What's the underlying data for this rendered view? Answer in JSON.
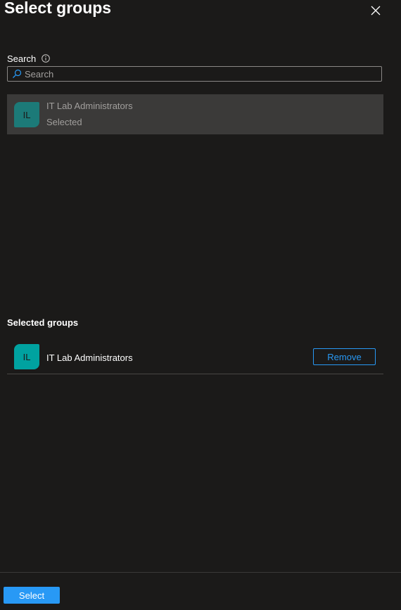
{
  "panel": {
    "title": "Select groups"
  },
  "icons": {
    "close": "close-icon",
    "info": "info-icon",
    "search": "search-icon"
  },
  "search": {
    "label": "Search",
    "placeholder": "Search",
    "value": ""
  },
  "results": [
    {
      "initials": "IL",
      "name": "IT Lab Administrators",
      "status": "Selected",
      "avatar_color": "#1c7a78"
    }
  ],
  "selected_section": {
    "title": "Selected groups",
    "items": [
      {
        "initials": "IL",
        "name": "IT Lab Administrators",
        "avatar_color": "#00a2a0",
        "remove_label": "Remove"
      }
    ]
  },
  "footer": {
    "select_label": "Select"
  },
  "colors": {
    "background": "#1b1a19",
    "accent": "#2899f5",
    "selected_row_bg": "#3b3a39"
  }
}
